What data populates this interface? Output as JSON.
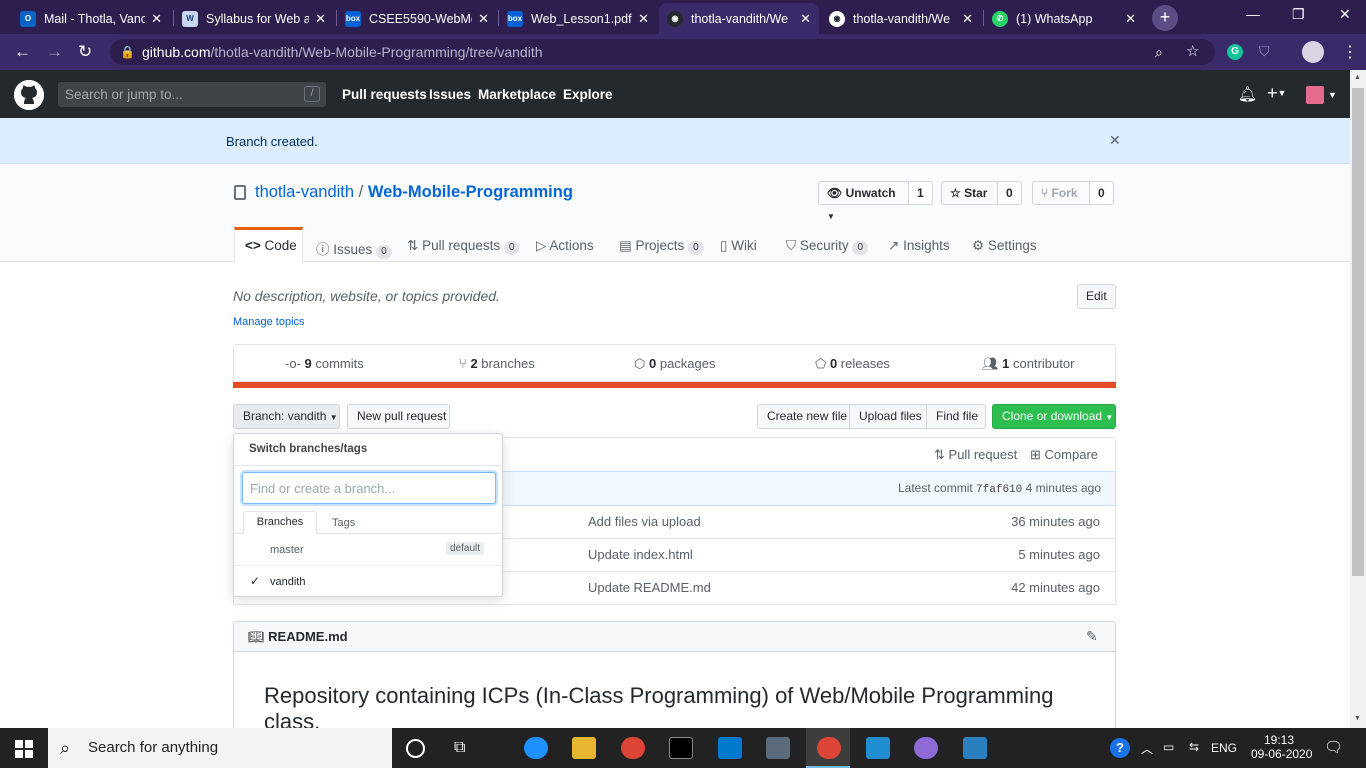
{
  "browser": {
    "tabs": [
      {
        "title": "Mail - Thotla, Vanc",
        "icon": "outlook-icon",
        "color": "#0a64c8"
      },
      {
        "title": "Syllabus for Web a",
        "icon": "canvas-icon",
        "color": "#c9d8f0"
      },
      {
        "title": "CSEE5590-WebMo",
        "icon": "box-icon",
        "color": "#0061d5"
      },
      {
        "title": "Web_Lesson1.pdf",
        "icon": "box-icon",
        "color": "#0061d5"
      },
      {
        "title": "thotla-vandith/We",
        "icon": "github-icon",
        "color": "#24292e"
      },
      {
        "title": "thotla-vandith/We",
        "icon": "github-icon",
        "color": "#24292e"
      },
      {
        "title": "(1) WhatsApp",
        "icon": "whatsapp-icon",
        "color": "#25d366"
      }
    ],
    "url_host": "github.com",
    "url_path": "/thotla-vandith/Web-Mobile-Programming/tree/vandith"
  },
  "github_header": {
    "search_placeholder": "Search or jump to...",
    "slash_key": "/",
    "nav": [
      "Pull requests",
      "Issues",
      "Marketplace",
      "Explore"
    ],
    "plus": "+"
  },
  "flash": {
    "message": "Branch created."
  },
  "repo": {
    "owner": "thotla-vandith",
    "separator": "/",
    "name": "Web-Mobile-Programming",
    "unwatch_label": "Unwatch",
    "watch_count": "1",
    "star_label": "Star",
    "star_count": "0",
    "fork_label": "Fork",
    "fork_count": "0"
  },
  "tabs": {
    "code": "Code",
    "issues": "Issues",
    "issues_count": "0",
    "pulls": "Pull requests",
    "pulls_count": "0",
    "actions": "Actions",
    "projects": "Projects",
    "projects_count": "0",
    "wiki": "Wiki",
    "security": "Security",
    "security_count": "0",
    "insights": "Insights",
    "settings": "Settings"
  },
  "about": {
    "description": "No description, website, or topics provided.",
    "manage_topics": "Manage topics",
    "edit": "Edit"
  },
  "summary": {
    "commits_count": "9",
    "commits_label": "commits",
    "branches_count": "2",
    "branches_label": "branches",
    "packages_count": "0",
    "packages_label": "packages",
    "releases_count": "0",
    "releases_label": "releases",
    "contributors_count": "1",
    "contributors_label": "contributor",
    "language_color": "#e34c26"
  },
  "toolbar": {
    "branch_button": "Branch: vandith",
    "new_pull_request": "New pull request",
    "create_new_file": "Create new file",
    "upload_files": "Upload files",
    "find_file": "Find file",
    "clone_download": "Clone or download"
  },
  "commit_bar": {
    "pull_request": "Pull request",
    "compare": "Compare",
    "latest_label": "Latest commit",
    "sha": "7faf610",
    "age": "4 minutes ago"
  },
  "files": [
    {
      "message": "Add files via upload",
      "age": "36 minutes ago"
    },
    {
      "message": "Update index.html",
      "age": "5 minutes ago"
    },
    {
      "message": "Update README.md",
      "age": "42 minutes ago"
    }
  ],
  "branch_dropdown": {
    "title": "Switch branches/tags",
    "placeholder": "Find or create a branch...",
    "tab_branches": "Branches",
    "tab_tags": "Tags",
    "branches": [
      {
        "name": "master",
        "badge": "default",
        "selected": false
      },
      {
        "name": "vandith",
        "badge": "",
        "selected": true
      }
    ]
  },
  "readme": {
    "filename": "README.md",
    "heading": "Repository containing ICPs (In-Class Programming) of Web/Mobile Programming class."
  },
  "taskbar": {
    "search_placeholder": "Search for anything",
    "language": "ENG",
    "time": "19:13",
    "date": "09-06-2020"
  }
}
